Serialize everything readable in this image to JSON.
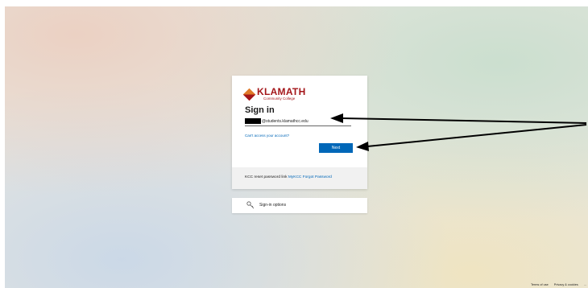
{
  "brand": {
    "name": "KLAMATH",
    "sub": "Community College",
    "colors": {
      "primary": "#a4161a",
      "secondary": "#e07a2a"
    }
  },
  "signin": {
    "title": "Sign in",
    "email_value": "@students.klamathcc.edu",
    "cant_access": "Can't access your account?",
    "next_label": "Next",
    "accent": "#0067b8"
  },
  "footer": {
    "text": "KCC reset password link ",
    "link": "MyKCC Forgot Password"
  },
  "signin_options": {
    "label": "Sign-in options",
    "icon": "key-icon"
  },
  "page_footer": {
    "terms": "Terms of use",
    "privacy": "Privacy & cookies",
    "more": "..."
  }
}
